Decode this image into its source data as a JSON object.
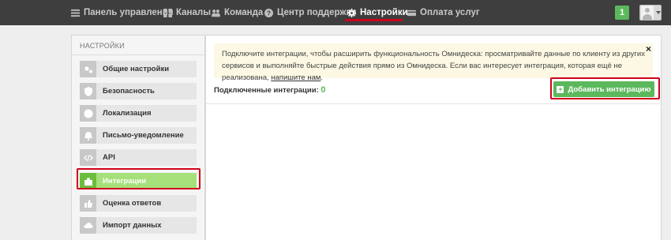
{
  "topnav": {
    "items": [
      {
        "label": "Панель управления",
        "icon": "list-icon"
      },
      {
        "label": "Каналы",
        "icon": "grid-icon"
      },
      {
        "label": "Команда",
        "icon": "users-icon"
      },
      {
        "label": "Центр поддержки",
        "icon": "question-icon"
      },
      {
        "label": "Настройки",
        "icon": "gear-icon",
        "active": true
      },
      {
        "label": "Оплата услуг",
        "icon": "card-icon"
      }
    ],
    "badge": "1",
    "highlight_color": "#d0021b"
  },
  "sidebar": {
    "title": "НАСТРОЙКИ",
    "items": [
      {
        "label": "Общие настройки",
        "icon": "gears-icon"
      },
      {
        "label": "Безопасность",
        "icon": "shield-icon"
      },
      {
        "label": "Локализация",
        "icon": "globe-icon"
      },
      {
        "label": "Письмо-уведомление",
        "icon": "bell-icon"
      },
      {
        "label": "API",
        "icon": "code-icon"
      },
      {
        "label": "Интеграции",
        "icon": "puzzle-icon",
        "active": true
      },
      {
        "label": "Оценка ответов",
        "icon": "thumbs-up-icon"
      },
      {
        "label": "Импорт данных",
        "icon": "cloud-upload-icon"
      }
    ]
  },
  "main": {
    "notice": {
      "text": "Подключите интеграции, чтобы расширить функциональность Омнидеска: просматривайте данные по клиенту из других сервисов и выполняйте быстрые действия прямо из Омнидеска. Если вас интересует интеграция, которая ещё не реализована, ",
      "link": "напишите нам",
      "end": "."
    },
    "close": "×",
    "connected_label": "Подключенные интеграции:",
    "connected_count": "0",
    "add_button": "Добавить интеграцию",
    "accent_color": "#5cb85c"
  }
}
